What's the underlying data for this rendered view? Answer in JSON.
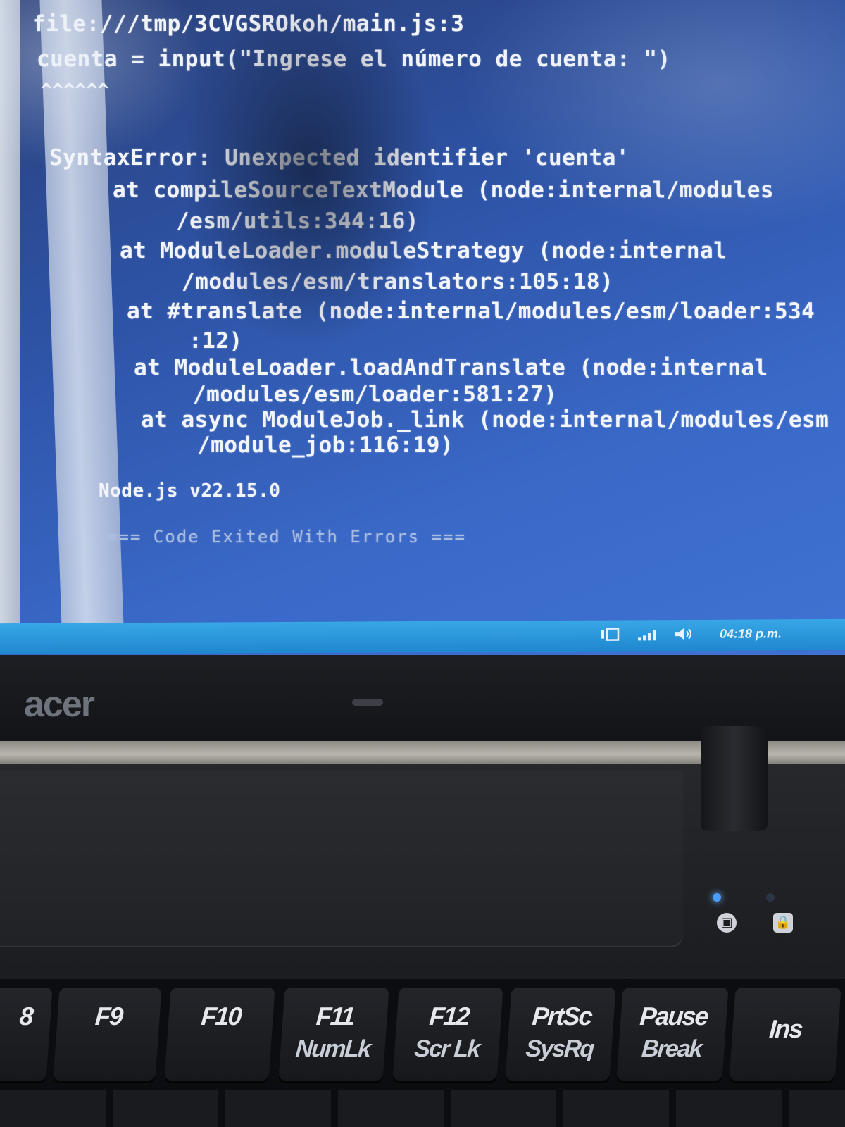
{
  "console": {
    "lines": [
      "file:///tmp/3CVGSROkoh/main.js:3",
      "cuenta = input(\"Ingrese el número de cuenta: \")",
      "^^^^^^",
      "SyntaxError: Unexpected identifier 'cuenta'",
      "at compileSourceTextModule (node:internal/modules",
      "/esm/utils:344:16)",
      "at ModuleLoader.moduleStrategy (node:internal",
      "/modules/esm/translators:105:18)",
      "at #translate (node:internal/modules/esm/loader:534",
      ":12)",
      "at ModuleLoader.loadAndTranslate (node:internal",
      "/modules/esm/loader:581:27)",
      "at async ModuleJob._link (node:internal/modules/esm",
      "/module_job:116:19)",
      "Node.js v22.15.0",
      "=== Code Exited With Errors ==="
    ]
  },
  "taskbar": {
    "icons": [
      "network-icon",
      "signal-icon",
      "volume-icon"
    ],
    "clock": "04:18 p.m."
  },
  "laptop": {
    "brand": "acer",
    "indicators": [
      "battery-indicator-icon",
      "lock-indicator-icon"
    ]
  },
  "keyboard": {
    "keys": [
      {
        "top": "8",
        "bottom": ""
      },
      {
        "top": "F9",
        "bottom": ""
      },
      {
        "top": "F10",
        "bottom": ""
      },
      {
        "top": "F11",
        "bottom": "NumLk"
      },
      {
        "top": "F12",
        "bottom": "Scr Lk"
      },
      {
        "top": "PrtSc",
        "bottom": "SysRq"
      },
      {
        "top": "Pause",
        "bottom": "Break"
      },
      {
        "top": "Ins",
        "bottom": ""
      }
    ]
  },
  "colors": {
    "screen_bg": "#2d52a4",
    "taskbar": "#1f87cf",
    "console_text": "#f2f5fb",
    "power_led": "#4a9cff"
  }
}
